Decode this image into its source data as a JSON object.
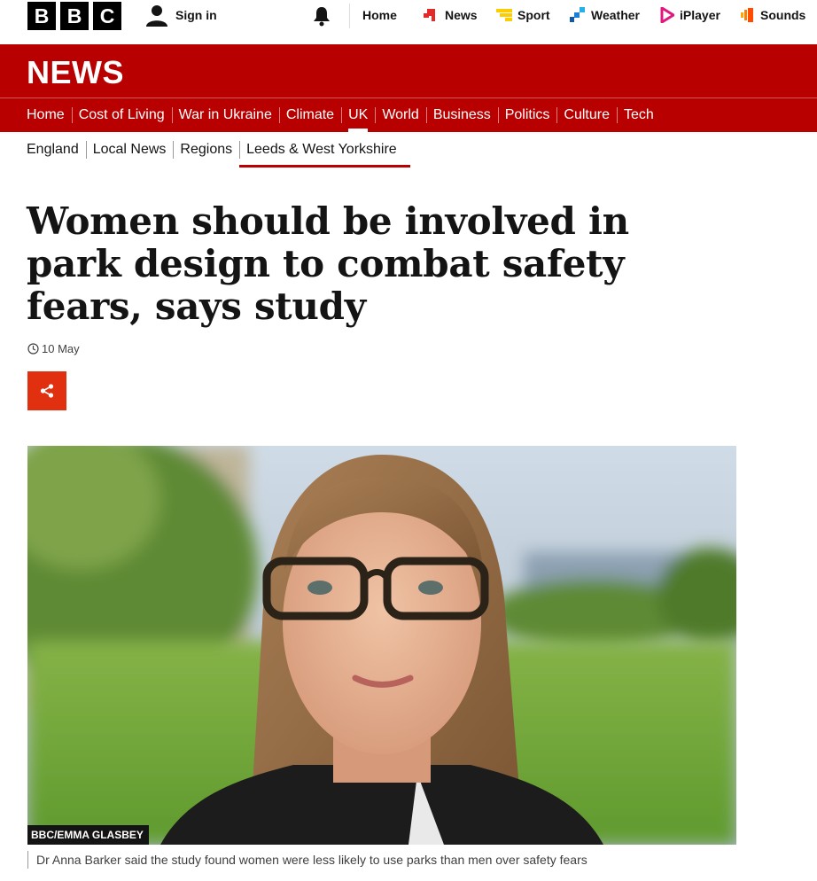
{
  "brand": {
    "letters": [
      "B",
      "B",
      "C"
    ]
  },
  "account": {
    "signin_label": "Sign in"
  },
  "topnav": {
    "items": [
      {
        "label": "Home",
        "icon": "none"
      },
      {
        "label": "News",
        "icon": "news-icon",
        "color": "#e22b29"
      },
      {
        "label": "Sport",
        "icon": "sport-icon",
        "color": "#fccd00"
      },
      {
        "label": "Weather",
        "icon": "weather-icon",
        "color": "#1c7ed6"
      },
      {
        "label": "iPlayer",
        "icon": "iplayer-icon",
        "color": "#e0187f"
      },
      {
        "label": "Sounds",
        "icon": "sounds-icon",
        "color": "#ff6600"
      }
    ]
  },
  "news": {
    "title": "NEWS",
    "band_color": "#b80000",
    "sections": [
      {
        "label": "Home"
      },
      {
        "label": "Cost of Living"
      },
      {
        "label": "War in Ukraine"
      },
      {
        "label": "Climate"
      },
      {
        "label": "UK",
        "active": true
      },
      {
        "label": "World"
      },
      {
        "label": "Business"
      },
      {
        "label": "Politics"
      },
      {
        "label": "Culture"
      },
      {
        "label": "Tech"
      }
    ]
  },
  "subnav": {
    "items": [
      {
        "label": "England"
      },
      {
        "label": "Local News"
      },
      {
        "label": "Regions"
      },
      {
        "label": "Leeds & West Yorkshire",
        "active": true
      }
    ]
  },
  "article": {
    "headline": "Women should be involved in park design to combat safety fears, says study",
    "date": "10 May",
    "share_color": "#e0300f",
    "image": {
      "credit": "BBC/EMMA GLASBEY",
      "caption": "Dr Anna Barker said the study found women were less likely to use parks than men over safety fears"
    }
  }
}
